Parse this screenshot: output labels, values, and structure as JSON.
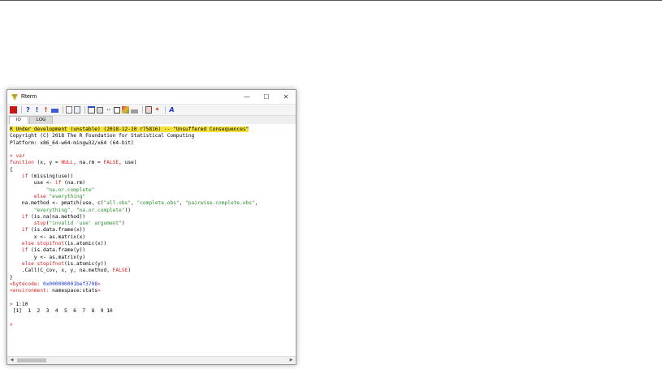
{
  "window": {
    "title": "Rterm",
    "minimize": "—",
    "maximize": "☐",
    "close": "✕"
  },
  "tabs": [
    "IO",
    "LOG"
  ],
  "console_lines": [
    [
      {
        "t": "R Under development (unstable) (2018-12-10 r75816) -- \"Unsuffered Consequences\"",
        "c": "hl"
      }
    ],
    [
      {
        "t": "Copyright (C) 2018 The R Foundation for Statistical Computing",
        "c": ""
      }
    ],
    [
      {
        "t": "Platform: x86_64-w64-mingw32/x64 (64-bit)",
        "c": ""
      }
    ],
    [
      {
        "t": "",
        "c": ""
      }
    ],
    [
      {
        "t": "> ",
        "c": "prompt"
      },
      {
        "t": "var",
        "c": "red"
      }
    ],
    [
      {
        "t": "function",
        "c": "red"
      },
      {
        "t": " (x, y = ",
        "c": ""
      },
      {
        "t": "NULL",
        "c": "red"
      },
      {
        "t": ", na.rm = ",
        "c": ""
      },
      {
        "t": "FALSE",
        "c": "red"
      },
      {
        "t": ", use)",
        "c": ""
      }
    ],
    [
      {
        "t": "{",
        "c": ""
      }
    ],
    [
      {
        "t": "    ",
        "c": ""
      },
      {
        "t": "if",
        "c": "red"
      },
      {
        "t": " (missing(use))",
        "c": ""
      }
    ],
    [
      {
        "t": "        use <- ",
        "c": ""
      },
      {
        "t": "if",
        "c": "red"
      },
      {
        "t": " (na.rm)",
        "c": ""
      }
    ],
    [
      {
        "t": "            \"na.or.complete\"",
        "c": "str"
      }
    ],
    [
      {
        "t": "        ",
        "c": ""
      },
      {
        "t": "else",
        "c": "red"
      },
      {
        "t": " \"everything\"",
        "c": "str"
      }
    ],
    [
      {
        "t": "    na.method <- pmatch(use, c(",
        "c": ""
      },
      {
        "t": "\"all.obs\"",
        "c": "str"
      },
      {
        "t": ", ",
        "c": ""
      },
      {
        "t": "\"complete.obs\"",
        "c": "str"
      },
      {
        "t": ", ",
        "c": ""
      },
      {
        "t": "\"pairwise.complete.obs\"",
        "c": "str"
      },
      {
        "t": ",",
        "c": ""
      }
    ],
    [
      {
        "t": "        \"everything\", \"na.or.complete\"",
        "c": "str"
      },
      {
        "t": "))",
        "c": ""
      }
    ],
    [
      {
        "t": "    ",
        "c": ""
      },
      {
        "t": "if",
        "c": "red"
      },
      {
        "t": " (is.na(na.method))",
        "c": ""
      }
    ],
    [
      {
        "t": "        ",
        "c": ""
      },
      {
        "t": "stop",
        "c": "red"
      },
      {
        "t": "(",
        "c": ""
      },
      {
        "t": "\"invalid 'use' argument\"",
        "c": "str"
      },
      {
        "t": ")",
        "c": ""
      }
    ],
    [
      {
        "t": "    ",
        "c": ""
      },
      {
        "t": "if",
        "c": "red"
      },
      {
        "t": " (is.data.frame(x))",
        "c": ""
      }
    ],
    [
      {
        "t": "        x <- as.matrix(x)",
        "c": ""
      }
    ],
    [
      {
        "t": "    ",
        "c": ""
      },
      {
        "t": "else stopifnot",
        "c": "red"
      },
      {
        "t": "(is.atomic(x))",
        "c": ""
      }
    ],
    [
      {
        "t": "    ",
        "c": ""
      },
      {
        "t": "if",
        "c": "red"
      },
      {
        "t": " (is.data.frame(y))",
        "c": ""
      }
    ],
    [
      {
        "t": "        y <- as.matrix(y)",
        "c": ""
      }
    ],
    [
      {
        "t": "    ",
        "c": ""
      },
      {
        "t": "else stopifnot",
        "c": "red"
      },
      {
        "t": "(is.atomic(y))",
        "c": ""
      }
    ],
    [
      {
        "t": "    .Call(C_cov, x, y, na.method, ",
        "c": ""
      },
      {
        "t": "FALSE",
        "c": "red"
      },
      {
        "t": ")",
        "c": ""
      }
    ],
    [
      {
        "t": "}",
        "c": ""
      }
    ],
    [
      {
        "t": "<bytecode: ",
        "c": "red"
      },
      {
        "t": "0x000000001bef3708",
        "c": "blue"
      },
      {
        "t": ">",
        "c": "red"
      }
    ],
    [
      {
        "t": "<environment: ",
        "c": "red"
      },
      {
        "t": "namespace:stats",
        "c": ""
      },
      {
        "t": ">",
        "c": "red"
      }
    ],
    [
      {
        "t": "",
        "c": ""
      }
    ],
    [
      {
        "t": "> ",
        "c": "prompt"
      },
      {
        "t": "1:10",
        "c": ""
      }
    ],
    [
      {
        "t": " [1]  1  2  3  4  5  6  7  8  9 10",
        "c": ""
      }
    ],
    [
      {
        "t": "",
        "c": ""
      }
    ],
    [
      {
        "t": ">",
        "c": "prompt"
      }
    ]
  ],
  "toolbar_icons": [
    "console-icon",
    "help-icon",
    "stop-icon",
    "interrupt-icon",
    "keyboard-icon",
    "copy-icon",
    "paste-icon",
    "window-icon",
    "settings-icon",
    "code-icon",
    "edit-icon",
    "palette-icon",
    "packages-icon",
    "files-icon",
    "pin-icon",
    "font-icon"
  ],
  "colors": {
    "highlight": "#f4e13b",
    "keyword": "#d81f1f",
    "string": "#2f8c2f",
    "hex": "#1a33d6"
  }
}
